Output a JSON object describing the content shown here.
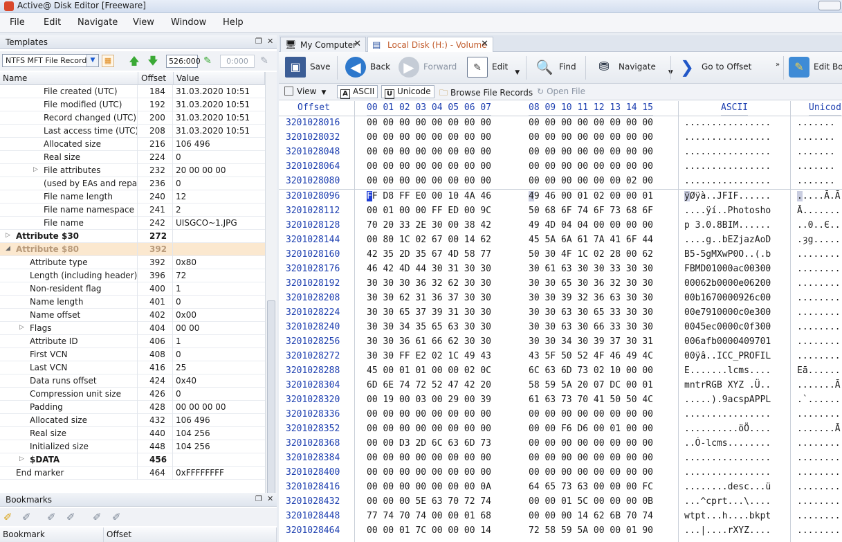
{
  "window": {
    "title": "Active@ Disk Editor [Freeware]"
  },
  "menu": [
    "File",
    "Edit",
    "Navigate",
    "View",
    "Window",
    "Help"
  ],
  "templates": {
    "title": "Templates",
    "template_select": "NTFS MFT File Record",
    "offset_value": "526:000",
    "offset2_value": "0:000",
    "columns": [
      "Name",
      "Offset",
      "Value"
    ],
    "rows": [
      {
        "name": "File created (UTC)",
        "offset": "184",
        "value": "31.03.2020 10:51",
        "indent": 3
      },
      {
        "name": "File modified (UTC)",
        "offset": "192",
        "value": "31.03.2020 10:51",
        "indent": 3
      },
      {
        "name": "Record changed (UTC)",
        "offset": "200",
        "value": "31.03.2020 10:51",
        "indent": 3
      },
      {
        "name": "Last access time (UTC)",
        "offset": "208",
        "value": "31.03.2020 10:51",
        "indent": 3
      },
      {
        "name": "Allocated size",
        "offset": "216",
        "value": "106 496",
        "indent": 3
      },
      {
        "name": "Real size",
        "offset": "224",
        "value": "0",
        "indent": 3
      },
      {
        "name": "File attributes",
        "offset": "232",
        "value": "20 00 00 00",
        "indent": 3,
        "expander": "▷"
      },
      {
        "name": "(used by EAs and repar...",
        "offset": "236",
        "value": "0",
        "indent": 3
      },
      {
        "name": "File name length",
        "offset": "240",
        "value": "12",
        "indent": 3
      },
      {
        "name": "File name namespace",
        "offset": "241",
        "value": "2",
        "indent": 3
      },
      {
        "name": "File name",
        "offset": "242",
        "value": "UISGCO~1.JPG",
        "indent": 3
      },
      {
        "name": "Attribute $30",
        "offset": "272",
        "value": "",
        "indent": 1,
        "expander": "▷",
        "bold": true
      },
      {
        "name": "Attribute $80",
        "offset": "392",
        "value": "",
        "indent": 1,
        "expander": "◢",
        "bold": true,
        "highlight": true
      },
      {
        "name": "Attribute type",
        "offset": "392",
        "value": "0x80",
        "indent": 2
      },
      {
        "name": "Length (including header)",
        "offset": "396",
        "value": "72",
        "indent": 2
      },
      {
        "name": "Non-resident flag",
        "offset": "400",
        "value": "1",
        "indent": 2
      },
      {
        "name": "Name length",
        "offset": "401",
        "value": "0",
        "indent": 2
      },
      {
        "name": "Name offset",
        "offset": "402",
        "value": "0x00",
        "indent": 2
      },
      {
        "name": "Flags",
        "offset": "404",
        "value": "00 00",
        "indent": 2,
        "expander": "▷"
      },
      {
        "name": "Attribute ID",
        "offset": "406",
        "value": "1",
        "indent": 2
      },
      {
        "name": "First VCN",
        "offset": "408",
        "value": "0",
        "indent": 2
      },
      {
        "name": "Last VCN",
        "offset": "416",
        "value": "25",
        "indent": 2
      },
      {
        "name": "Data runs offset",
        "offset": "424",
        "value": "0x40",
        "indent": 2
      },
      {
        "name": "Compression unit size",
        "offset": "426",
        "value": "0",
        "indent": 2
      },
      {
        "name": "Padding",
        "offset": "428",
        "value": "00 00 00 00",
        "indent": 2
      },
      {
        "name": "Allocated size",
        "offset": "432",
        "value": "106 496",
        "indent": 2
      },
      {
        "name": "Real size",
        "offset": "440",
        "value": "104 256",
        "indent": 2
      },
      {
        "name": "Initialized size",
        "offset": "448",
        "value": "104 256",
        "indent": 2
      },
      {
        "name": "$DATA",
        "offset": "456",
        "value": "",
        "indent": 2,
        "expander": "▷",
        "bold": true
      },
      {
        "name": "End marker",
        "offset": "464",
        "value": "0xFFFFFFFF",
        "indent": 1
      }
    ]
  },
  "bookmarks": {
    "title": "Bookmarks",
    "columns": [
      "Bookmark",
      "Offset"
    ]
  },
  "tabs": [
    {
      "label": "My Computer",
      "active": false
    },
    {
      "label": "Local Disk (H:) - Volume",
      "active": true
    }
  ],
  "toolbar": {
    "save": "Save",
    "back": "Back",
    "forward": "Forward",
    "edit": "Edit",
    "find": "Find",
    "navigate": "Navigate",
    "go_to_offset": "Go to Offset",
    "edit_boot": "Edit Boo",
    "view": "View",
    "ascii": "ASCII",
    "unicode": "Unicode",
    "browse": "Browse File Records",
    "open_file": "Open File"
  },
  "hex": {
    "header_offset": "Offset",
    "header_bytes1": "00 01 02 03 04 05 06 07",
    "header_bytes2": "08 09 10 11 12 13 14 15",
    "header_ascii": "ASCII",
    "header_unicode": "Unicod",
    "rows": [
      {
        "o": "3201028016",
        "b1": "00 00 00 00 00 00 00 00",
        "b2": "00 00 00 00 00 00 00 00",
        "a": "................",
        "u": "......."
      },
      {
        "o": "3201028032",
        "b1": "00 00 00 00 00 00 00 00",
        "b2": "00 00 00 00 00 00 00 00",
        "a": "................",
        "u": "......."
      },
      {
        "o": "3201028048",
        "b1": "00 00 00 00 00 00 00 00",
        "b2": "00 00 00 00 00 00 00 00",
        "a": "................",
        "u": "......."
      },
      {
        "o": "3201028064",
        "b1": "00 00 00 00 00 00 00 00",
        "b2": "00 00 00 00 00 00 00 00",
        "a": "................",
        "u": "......."
      },
      {
        "o": "3201028080",
        "b1": "00 00 00 00 00 00 00 00",
        "b2": "00 00 00 00 00 00 02 00",
        "a": "................",
        "u": "......."
      },
      {
        "o": "3201028096",
        "b1": "FF D8 FF E0 00 10 4A 46",
        "b2": "49 46 00 01 02 00 00 01",
        "a": "ÿØÿà..JFIF......",
        "u": ".....Ā.Ā"
      },
      {
        "o": "3201028112",
        "b1": "00 01 00 00 FF ED 00 9C",
        "b2": "50 68 6F 74 6F 73 68 6F",
        "a": "....ÿí..Photosho",
        "u": "Ā......."
      },
      {
        "o": "3201028128",
        "b1": "70 20 33 2E 30 00 38 42",
        "b2": "49 4D 04 04 00 00 00 00",
        "a": "p 3.0.8BIM......",
        "u": "..0..Є.."
      },
      {
        "o": "3201028144",
        "b1": "00 80 1C 02 67 00 14 62",
        "b2": "45 5A 6A 61 7A 41 6F 44",
        "a": "....g..bEZjazAoD",
        "u": ".ȝg....."
      },
      {
        "o": "3201028160",
        "b1": "42 35 2D 35 67 4D 58 77",
        "b2": "50 30 4F 1C 02 28 00 62",
        "a": "B5-5gMXwP0O..(.b",
        "u": "........"
      },
      {
        "o": "3201028176",
        "b1": "46 42 4D 44 30 31 30 30",
        "b2": "30 61 63 30 30 33 30 30",
        "a": "FBMD01000ac00300",
        "u": "........"
      },
      {
        "o": "3201028192",
        "b1": "30 30 30 36 32 62 30 30",
        "b2": "30 30 65 30 36 32 30 30",
        "a": "00062b0000e06200",
        "u": "........"
      },
      {
        "o": "3201028208",
        "b1": "30 30 62 31 36 37 30 30",
        "b2": "30 30 39 32 36 63 30 30",
        "a": "00b1670000926c00",
        "u": "........"
      },
      {
        "o": "3201028224",
        "b1": "30 30 65 37 39 31 30 30",
        "b2": "30 30 63 30 65 33 30 30",
        "a": "00e7910000c0e300",
        "u": "........"
      },
      {
        "o": "3201028240",
        "b1": "30 30 34 35 65 63 30 30",
        "b2": "30 30 63 30 66 33 30 30",
        "a": "0045ec0000c0f300",
        "u": "........"
      },
      {
        "o": "3201028256",
        "b1": "30 30 36 61 66 62 30 30",
        "b2": "30 30 34 30 39 37 30 31",
        "a": "006afb0000409701",
        "u": "........"
      },
      {
        "o": "3201028272",
        "b1": "30 30 FF E2 02 1C 49 43",
        "b2": "43 5F 50 52 4F 46 49 4C",
        "a": "00ÿâ..ICC_PROFIL",
        "u": "........"
      },
      {
        "o": "3201028288",
        "b1": "45 00 01 01 00 00 02 0C",
        "b2": "6C 63 6D 73 02 10 00 00",
        "a": "E.......lcms....",
        "u": "Eā......"
      },
      {
        "o": "3201028304",
        "b1": "6D 6E 74 72 52 47 42 20",
        "b2": "58 59 5A 20 07 DC 00 01",
        "a": "mntrRGB XYZ .Ü..",
        "u": ".......Ā"
      },
      {
        "o": "3201028320",
        "b1": "00 19 00 03 00 29 00 39",
        "b2": "61 63 73 70 41 50 50 4C",
        "a": ".....).9acspAPPL",
        "u": ".`......"
      },
      {
        "o": "3201028336",
        "b1": "00 00 00 00 00 00 00 00",
        "b2": "00 00 00 00 00 00 00 00",
        "a": "................",
        "u": "........"
      },
      {
        "o": "3201028352",
        "b1": "00 00 00 00 00 00 00 00",
        "b2": "00 00 F6 D6 00 01 00 00",
        "a": "..........öÖ....",
        "u": ".......Ā"
      },
      {
        "o": "3201028368",
        "b1": "00 00 D3 2D 6C 63 6D 73",
        "b2": "00 00 00 00 00 00 00 00",
        "a": "..Ó-lcms........",
        "u": "........"
      },
      {
        "o": "3201028384",
        "b1": "00 00 00 00 00 00 00 00",
        "b2": "00 00 00 00 00 00 00 00",
        "a": "................",
        "u": "........"
      },
      {
        "o": "3201028400",
        "b1": "00 00 00 00 00 00 00 00",
        "b2": "00 00 00 00 00 00 00 00",
        "a": "................",
        "u": "........"
      },
      {
        "o": "3201028416",
        "b1": "00 00 00 00 00 00 00 0A",
        "b2": "64 65 73 63 00 00 00 FC",
        "a": "........desc...ü",
        "u": "........"
      },
      {
        "o": "3201028432",
        "b1": "00 00 00 5E 63 70 72 74",
        "b2": "00 00 01 5C 00 00 00 0B",
        "a": "...^cprt...\\....",
        "u": "........"
      },
      {
        "o": "3201028448",
        "b1": "77 74 70 74 00 00 01 68",
        "b2": "00 00 00 14 62 6B 70 74",
        "a": "wtpt...h....bkpt",
        "u": "........"
      },
      {
        "o": "3201028464",
        "b1": "00 00 01 7C 00 00 00 14",
        "b2": "72 58 59 5A 00 00 01 90",
        "a": "...|....rXYZ....",
        "u": "........"
      }
    ]
  }
}
